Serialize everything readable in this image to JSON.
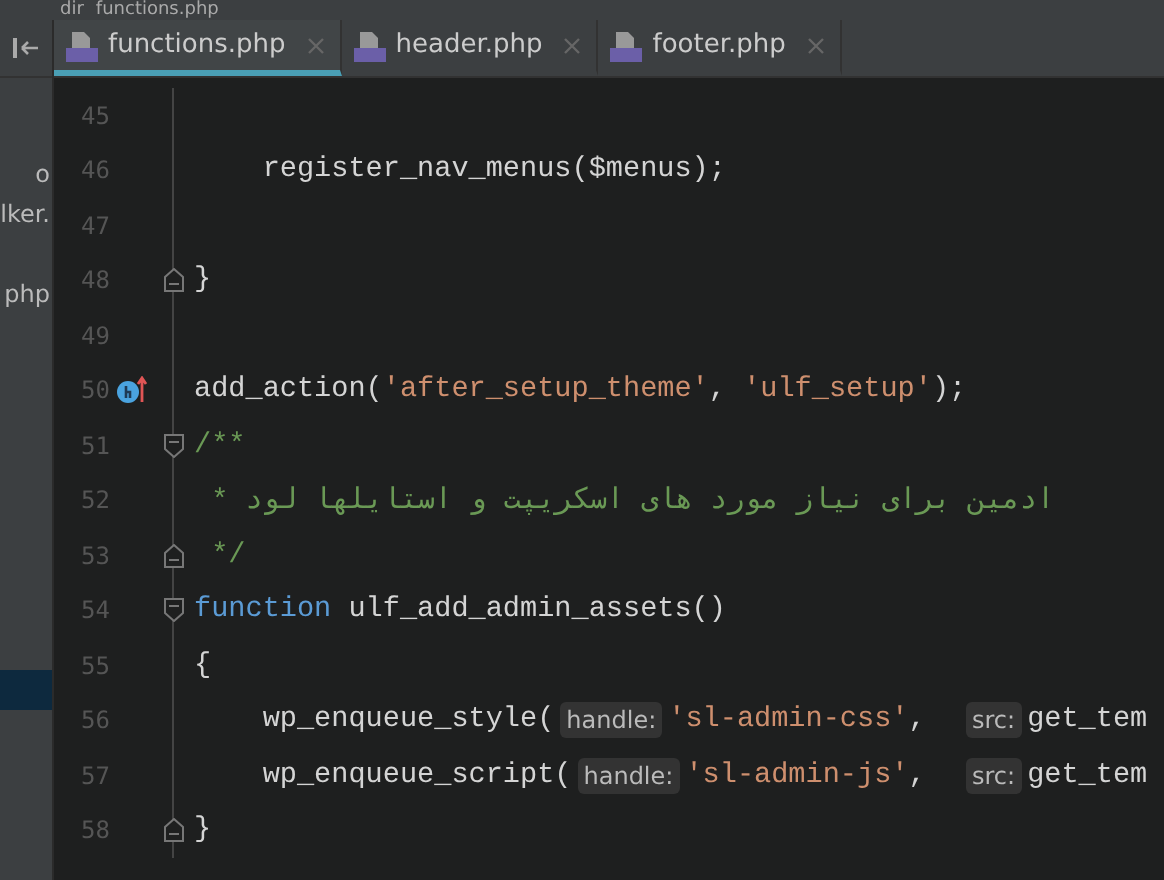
{
  "breadcrumbs": [
    "dir",
    "functions.php"
  ],
  "project_panel": {
    "items": [
      {
        "label": "o",
        "selected": false
      },
      {
        "label": "lker.",
        "selected": false
      },
      {
        "label": "php",
        "selected": false
      },
      {
        "selected": true
      }
    ]
  },
  "tabs": [
    {
      "label": "functions.php",
      "selected": true
    },
    {
      "label": "header.php",
      "selected": false
    },
    {
      "label": "footer.php",
      "selected": false
    }
  ],
  "lines": [
    {
      "number": "45"
    },
    {
      "number": "46",
      "tokens": [
        {
          "kind": "plain",
          "text": "    register_nav_menus($menus);"
        }
      ]
    },
    {
      "number": "47"
    },
    {
      "number": "48",
      "fold_end": true,
      "tokens": [
        {
          "kind": "plain",
          "text": "}"
        }
      ]
    },
    {
      "number": "49"
    },
    {
      "number": "50",
      "override_marker": true,
      "tokens": [
        {
          "kind": "plain",
          "text": "add_action("
        },
        {
          "kind": "string",
          "text": "'after_setup_theme'"
        },
        {
          "kind": "plain",
          "text": ", "
        },
        {
          "kind": "string",
          "text": "'ulf_setup'"
        },
        {
          "kind": "plain",
          "text": ");"
        }
      ]
    },
    {
      "number": "51",
      "fold_start": true,
      "tokens": [
        {
          "kind": "comment",
          "text": "/**"
        }
      ]
    },
    {
      "number": "52",
      "tokens": [
        {
          "kind": "comment",
          "text": " * ادمین برای نیاز مورد های اسکریپت و استایلها لود"
        }
      ]
    },
    {
      "number": "53",
      "fold_end": true,
      "tokens": [
        {
          "kind": "comment",
          "text": " */"
        }
      ]
    },
    {
      "number": "54",
      "fold_start": true,
      "tokens": [
        {
          "kind": "keyword",
          "text": "function"
        },
        {
          "kind": "plain",
          "text": " ulf_add_admin_assets()"
        }
      ]
    },
    {
      "number": "55",
      "tokens": [
        {
          "kind": "plain",
          "text": "{"
        }
      ]
    },
    {
      "number": "56",
      "tokens": [
        {
          "kind": "plain",
          "text": "    wp_enqueue_style("
        },
        {
          "kind": "hint",
          "text": "handle:"
        },
        {
          "kind": "string",
          "text": "'sl-admin-css'"
        },
        {
          "kind": "plain",
          "text": ",  "
        },
        {
          "kind": "hint",
          "text": "src:"
        },
        {
          "kind": "plain",
          "text": "get_tem"
        }
      ]
    },
    {
      "number": "57",
      "tokens": [
        {
          "kind": "plain",
          "text": "    wp_enqueue_script("
        },
        {
          "kind": "hint",
          "text": "handle:"
        },
        {
          "kind": "string",
          "text": "'sl-admin-js'"
        },
        {
          "kind": "plain",
          "text": ",  "
        },
        {
          "kind": "hint",
          "text": "src:"
        },
        {
          "kind": "plain",
          "text": "get_tem"
        }
      ]
    },
    {
      "number": "58",
      "fold_end": true,
      "tokens": [
        {
          "kind": "plain",
          "text": "}"
        }
      ]
    }
  ]
}
